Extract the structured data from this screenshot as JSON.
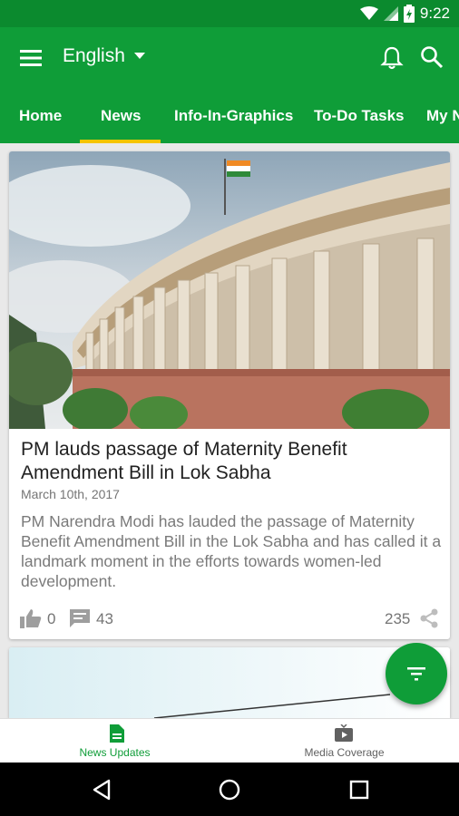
{
  "status_bar": {
    "time": "9:22",
    "icons": [
      "wifi-icon",
      "signal-icon",
      "battery-icon"
    ]
  },
  "app_bar": {
    "language": "English",
    "icons": [
      "menu-icon",
      "dropdown-arrow-icon",
      "bell-icon",
      "search-icon"
    ]
  },
  "tabs": [
    {
      "label": "Home",
      "selected": false
    },
    {
      "label": "News",
      "selected": true
    },
    {
      "label": "Info-In-Graphics",
      "selected": false
    },
    {
      "label": "To-Do Tasks",
      "selected": false
    },
    {
      "label": "My N",
      "selected": false
    }
  ],
  "article": {
    "title": "PM lauds passage of Maternity Benefit Amendment Bill in Lok Sabha",
    "date": "March 10th, 2017",
    "summary": "PM Narendra Modi has lauded the passage of Maternity Benefit Amendment Bill in the Lok Sabha and has called it a landmark moment in the efforts towards women-led development.",
    "likes": "0",
    "comments": "43",
    "shares": "235"
  },
  "bottom_nav": [
    {
      "label": "News Updates",
      "icon": "document-icon",
      "selected": true
    },
    {
      "label": "Media Coverage",
      "icon": "tv-play-icon",
      "selected": false
    }
  ],
  "colors": {
    "primary": "#0f9d38",
    "status_bar": "#0b8a2e",
    "tab_indicator": "#f5c400",
    "selected_nav": "#0f9d38",
    "unselected_nav": "#616161"
  }
}
